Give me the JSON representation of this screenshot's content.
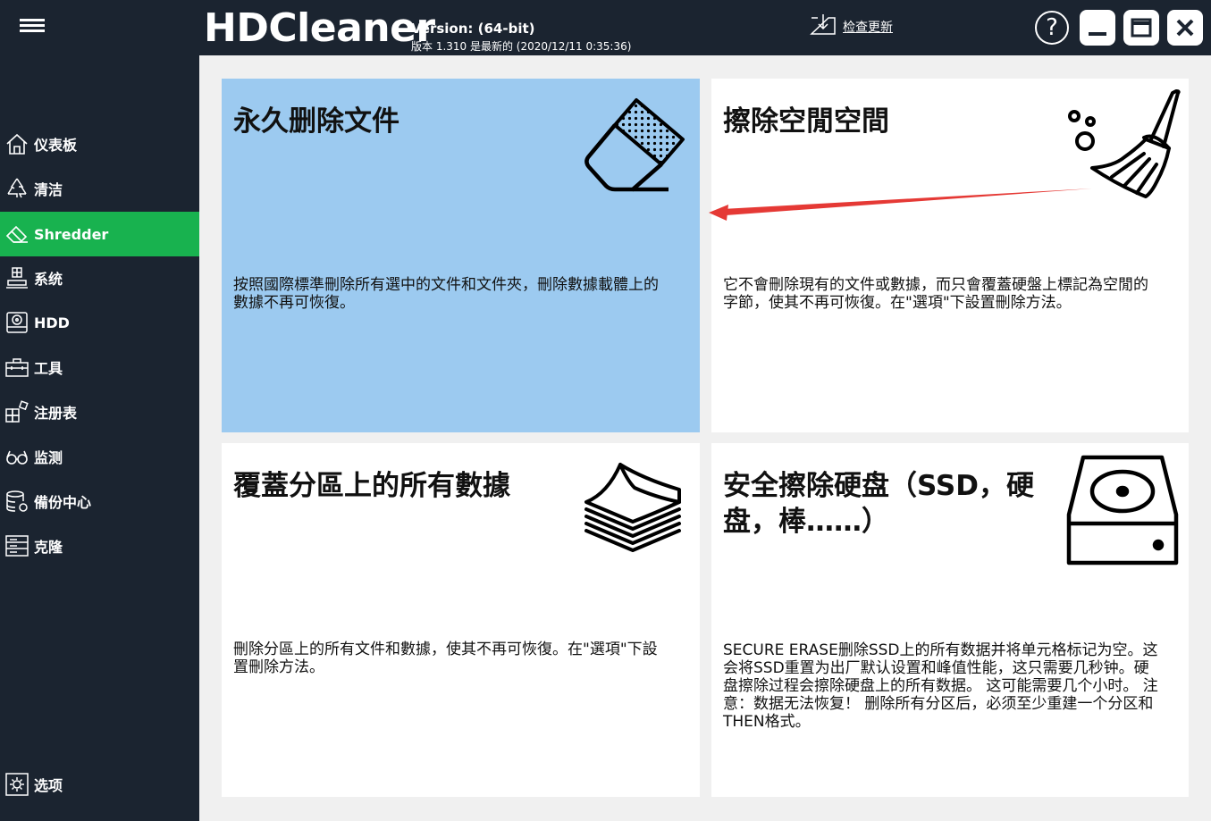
{
  "app": {
    "title": "HDCleaner",
    "version_line": "Version:  (64-bit)",
    "version_sub": "版本 1.310 是最新的 (2020/12/11 0:35:36)",
    "check_update": "检查更新",
    "help_symbol": "?"
  },
  "sidebar": {
    "items": [
      {
        "label": "仪表板",
        "icon": "home-icon"
      },
      {
        "label": "清洁",
        "icon": "recycle-icon"
      },
      {
        "label": "Shredder",
        "icon": "eraser-icon"
      },
      {
        "label": "系统",
        "icon": "computer-icon"
      },
      {
        "label": "HDD",
        "icon": "hdd-icon"
      },
      {
        "label": "工具",
        "icon": "toolbox-icon"
      },
      {
        "label": "注册表",
        "icon": "registry-icon"
      },
      {
        "label": "监测",
        "icon": "glasses-icon"
      },
      {
        "label": "備份中心",
        "icon": "database-icon"
      },
      {
        "label": "克隆",
        "icon": "clone-icon"
      }
    ],
    "active": "Shredder",
    "options": {
      "label": "选项",
      "icon": "settings-icon"
    }
  },
  "cards": [
    {
      "title": "永久删除文件",
      "desc": "按照國際標準刪除所有選中的文件和文件夾，刪除數據載體上的數據不再可恢復。",
      "icon": "eraser-icon",
      "selected": true
    },
    {
      "title": "擦除空閒空間",
      "desc": "它不會刪除現有的文件或數據，而只會覆蓋硬盤上標記為空閒的字節，使其不再可恢復。在\"選項\"下設置刪除方法。",
      "icon": "broom-icon",
      "selected": false
    },
    {
      "title": "覆蓋分區上的所有數據",
      "desc": "刪除分區上的所有文件和數據，使其不再可恢復。在\"選項\"下設置刪除方法。",
      "icon": "paper-stack-icon",
      "selected": false
    },
    {
      "title": "安全擦除硬盘（SSD，硬盘，棒……）",
      "desc": "SECURE ERASE删除SSD上的所有数据并将单元格标记为空。这会将SSD重置为出厂默认设置和峰值性能，这只需要几秒钟。硬盘擦除过程会擦除硬盘上的所有数据。 这可能需要几个小时。 注意：数据无法恢复！ 删除所有分区后，必须至少重建一个分区和THEN格式。",
      "icon": "hard-drive-icon",
      "selected": false
    }
  ],
  "colors": {
    "sidebar_bg": "#1b2430",
    "active_green": "#18b24f",
    "selected_card": "#9ccaf0",
    "annotation_arrow": "#e53935"
  }
}
